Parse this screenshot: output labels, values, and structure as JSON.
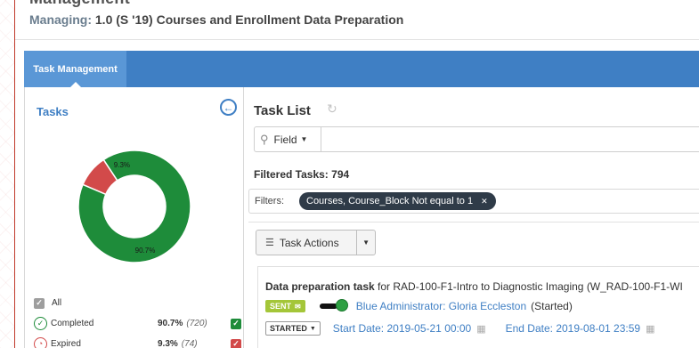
{
  "header": {
    "app_title": "Management",
    "managing_label": "Managing:",
    "managing_value": "1.0 (S '19) Courses and Enrollment Data Preparation"
  },
  "nav": {
    "tabs": [
      {
        "label": "Task Management",
        "active": true
      }
    ]
  },
  "left": {
    "title": "Tasks",
    "back_icon": "circle-arrow-left-icon",
    "chart_data": {
      "type": "pie",
      "donut": true,
      "categories": [
        "Completed",
        "Expired"
      ],
      "values": [
        90.7,
        9.3
      ],
      "labels": [
        "90.7%",
        "9.3%"
      ],
      "colors": [
        "#1e8c3a",
        "#d24a4a"
      ]
    },
    "legend": {
      "all_label": "All",
      "items": [
        {
          "name": "Completed",
          "pct": "90.7%",
          "count": "(720)",
          "color": "#1e8c3a",
          "checked": true
        },
        {
          "name": "Expired",
          "pct": "9.3%",
          "count": "(74)",
          "color": "#d24a4a",
          "checked": true
        }
      ]
    }
  },
  "right": {
    "title": "Task List",
    "search": {
      "field_label": "Field",
      "value": ""
    },
    "filtered_label": "Filtered Tasks:",
    "filtered_count": "794",
    "filters_label": "Filters:",
    "filter_chip": "Courses, Course_Block Not equal to 1",
    "actions_label": "Task Actions",
    "task": {
      "type": "Data preparation task",
      "rest": " for RAD-100-F1-Intro to Diagnostic Imaging (W_RAD-100-F1-WI",
      "sent_label": "SENT",
      "assignee": "Blue Administrator: Gloria Eccleston",
      "status_text": "(Started)",
      "status_btn": "STARTED",
      "start_date": "Start Date: 2019-05-21 00:00",
      "end_date": "End Date: 2019-08-01 23:59"
    }
  },
  "colors": {
    "brand_blue": "#3f7fc4",
    "tab_active": "#5a97d6",
    "completed": "#1e8c3a",
    "expired": "#d24a4a",
    "sent_badge": "#a4c639",
    "chip_bg": "#2f3b48"
  }
}
